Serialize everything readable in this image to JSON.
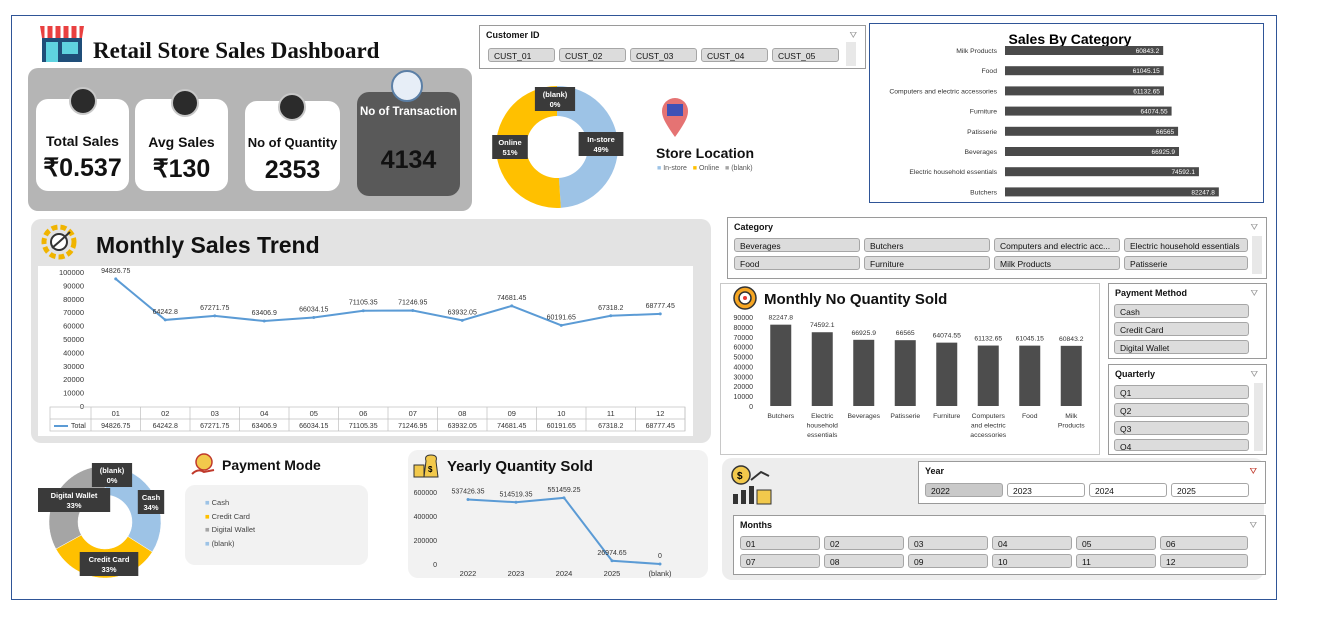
{
  "dashboard": {
    "title": "Retail Store Sales Dashboard",
    "kpis": [
      {
        "label": "Total Sales",
        "value": "₹0.537"
      },
      {
        "label": "Avg Sales",
        "value": "₹130"
      },
      {
        "label": "No of Quantity",
        "value": "2353"
      },
      {
        "label": "No of Transaction",
        "value": "4134"
      }
    ]
  },
  "customer_slicer": {
    "title": "Customer ID",
    "items": [
      "CUST_01",
      "CUST_02",
      "CUST_03",
      "CUST_04",
      "CUST_05"
    ]
  },
  "store_location": {
    "title": "Store Location",
    "legend": [
      "In-store",
      "Online",
      "(blank)"
    ],
    "labels": {
      "blank": "(blank)\n0%",
      "online": "Online\n51%",
      "instore": "In-store\n49%"
    }
  },
  "category_slicer": {
    "title": "Category",
    "items": [
      "Beverages",
      "Butchers",
      "Computers and electric acc...",
      "Electric household essentials",
      "Food",
      "Furniture",
      "Milk Products",
      "Patisserie"
    ]
  },
  "payment_slicer": {
    "title": "Payment Method",
    "items": [
      "Cash",
      "Credit Card",
      "Digital Wallet"
    ]
  },
  "quarter_slicer": {
    "title": "Quarterly",
    "items": [
      "Q1",
      "Q2",
      "Q3",
      "Q4"
    ]
  },
  "year_slicer": {
    "title": "Year",
    "items": [
      "2022",
      "2023",
      "2024",
      "2025"
    ]
  },
  "months_slicer": {
    "title": "Months",
    "items": [
      "01",
      "02",
      "03",
      "04",
      "05",
      "06",
      "07",
      "08",
      "09",
      "10",
      "11",
      "12"
    ]
  },
  "payment_mode": {
    "title": "Payment Mode",
    "legend": [
      "Cash",
      "Credit Card",
      "Digital Wallet",
      "(blank)"
    ]
  },
  "colors": {
    "blue": "#9dc3e6",
    "gold": "#ffc000",
    "gray": "#a5a5a5",
    "line": "#5b9bd5",
    "dark": "#595959"
  },
  "chart_data": [
    {
      "type": "bar",
      "title": "Sales By Category",
      "categories": [
        "Milk Products",
        "Food",
        "Computers and electric accessories",
        "Furniture",
        "Patisserie",
        "Beverages",
        "Electric household essentials",
        "Butchers"
      ],
      "values": [
        60843.2,
        61045.15,
        61132.65,
        64074.55,
        66565,
        66925.9,
        74592.1,
        82247.8
      ],
      "value_labels": [
        "60843.2",
        "61045.15",
        "61132.65",
        "64074.55",
        "66565",
        "66925.9",
        "74592.1",
        "82247.8"
      ],
      "orientation": "horizontal",
      "xlim": [
        0,
        100000
      ]
    },
    {
      "type": "line",
      "title": "Monthly Sales Trend",
      "categories": [
        "01",
        "02",
        "03",
        "04",
        "05",
        "06",
        "07",
        "08",
        "09",
        "10",
        "11",
        "12"
      ],
      "series": [
        {
          "name": "Total",
          "values": [
            94826.75,
            64242.8,
            67271.75,
            63406.9,
            66034.15,
            71105.35,
            71246.95,
            63932.05,
            74681.45,
            60191.65,
            67318.2,
            68777.45
          ]
        }
      ],
      "value_labels": [
        "94826.75",
        "64242.8",
        "67271.75",
        "63406.9",
        "66034.15",
        "71105.35",
        "71246.95",
        "63932.05",
        "74681.45",
        "60191.65",
        "67318.2",
        "68777.45"
      ],
      "yticks": [
        "0",
        "10000",
        "20000",
        "30000",
        "40000",
        "50000",
        "60000",
        "70000",
        "80000",
        "90000",
        "100000"
      ],
      "ylim": [
        0,
        100000
      ]
    },
    {
      "type": "bar",
      "title": "Monthly No Quantity Sold",
      "categories": [
        "Butchers",
        "Electric household essentials",
        "Beverages",
        "Patisserie",
        "Furniture",
        "Computers and electric accessories",
        "Food",
        "Milk Products"
      ],
      "tick_lines": [
        [
          "Butchers"
        ],
        [
          "Electric",
          "household",
          "essentials"
        ],
        [
          "Beverages"
        ],
        [
          "Patisserie"
        ],
        [
          "Furniture"
        ],
        [
          "Computers",
          "and electric",
          "accessories"
        ],
        [
          "Food"
        ],
        [
          "Milk",
          "Products"
        ]
      ],
      "values": [
        82247.8,
        74592.1,
        66925.9,
        66565,
        64074.55,
        61132.65,
        61045.15,
        60843.2
      ],
      "value_labels": [
        "82247.8",
        "74592.1",
        "66925.9",
        "66565",
        "64074.55",
        "61132.65",
        "61045.15",
        "60843.2"
      ],
      "yticks": [
        "0",
        "10000",
        "20000",
        "30000",
        "40000",
        "50000",
        "60000",
        "70000",
        "80000",
        "90000"
      ],
      "ylim": [
        0,
        90000
      ]
    },
    {
      "type": "pie",
      "title": "Payment Mode",
      "categories": [
        "Cash",
        "Credit Card",
        "Digital Wallet",
        "(blank)"
      ],
      "values": [
        34,
        33,
        33,
        0
      ],
      "labels": [
        "Cash\n34%",
        "Credit Card\n33%",
        "Digital Wallet\n33%",
        "(blank)\n0%"
      ]
    },
    {
      "type": "line",
      "title": "Yearly Quantity Sold",
      "categories": [
        "2022",
        "2023",
        "2024",
        "2025",
        "(blank)"
      ],
      "values": [
        537426.35,
        514519.35,
        551459.25,
        26974.65,
        0
      ],
      "value_labels": [
        "537426.35",
        "514519.35",
        "551459.25",
        "26974.65",
        "0"
      ],
      "yticks": [
        "0",
        "200000",
        "400000",
        "600000"
      ],
      "ylim": [
        0,
        600000
      ]
    },
    {
      "type": "pie",
      "title": "Store Location",
      "categories": [
        "In-store",
        "Online",
        "(blank)"
      ],
      "values": [
        49,
        51,
        0
      ]
    }
  ]
}
